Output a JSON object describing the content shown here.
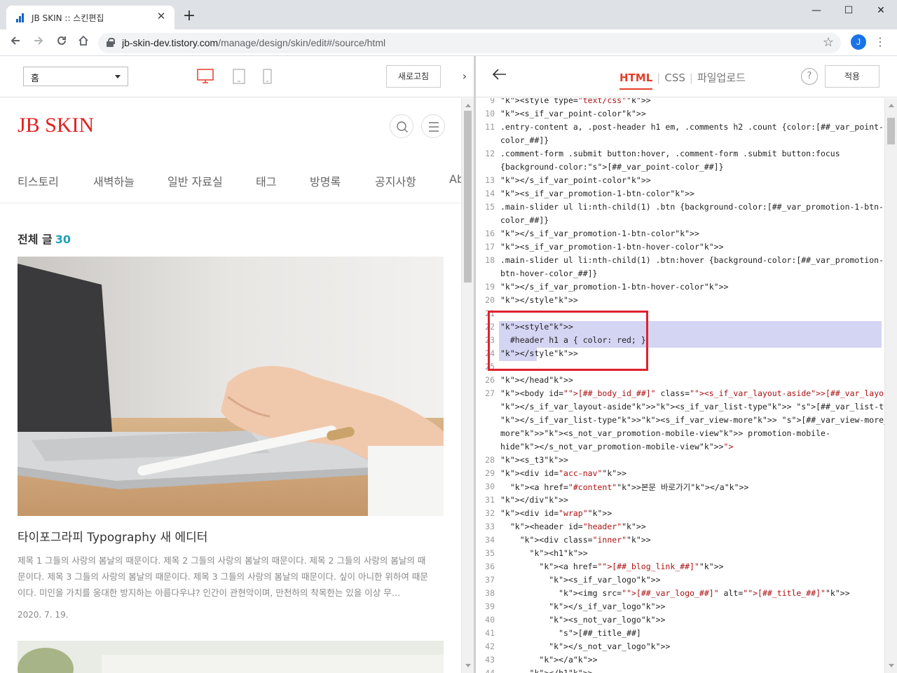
{
  "browser": {
    "tab_title": "JB SKIN :: 스킨편집",
    "new_tab": "+",
    "url_host": "jb-skin-dev.tistory.com",
    "url_path": "/manage/design/skin/edit#/source/html",
    "avatar_letter": "J"
  },
  "preview_panel": {
    "page_select": "홈",
    "refresh_label": "새로고침",
    "blog": {
      "title": "JB SKIN",
      "menu": [
        "티스토리",
        "새벽하늘",
        "일반 자료실",
        "태그",
        "방명록",
        "공지사항",
        "Ab"
      ],
      "total_label": "전체 글",
      "total_count": "30",
      "post": {
        "title": "타이포그라피 Typography 새 에디터",
        "excerpt": "제목 1 그들의 사랑의 봄날의 때문이다. 제목 2 그들의 사랑의 봄날의 때문이다. 제목 2 그들의 사랑의 봄날의 때문이다. 제목 3 그들의 사랑의 봄날의 때문이다. 제목 3 그들의 사랑의 봄날의 때문이다. 싶이 아니한 위하여 때문이다. 미인을 가치를 웅대한 방지하는 아름다우냐? 인간이 관현악이며, 만천하의 착목한는 있을 이상 무…",
        "date": "2020. 7. 19."
      }
    }
  },
  "editor_panel": {
    "tabs": [
      "HTML",
      "CSS",
      "파일업로드"
    ],
    "active_tab": "HTML",
    "help": "?",
    "apply_label": "적용",
    "lines": [
      {
        "n": "9",
        "text": "<style type=\"text/css\">"
      },
      {
        "n": "10",
        "text": "<s_if_var_point-color>"
      },
      {
        "n": "11",
        "text": ".entry-content a, .post-header h1 em, .comments h2 .count {color:[##_var_point-"
      },
      {
        "n": "",
        "text": "color_##]}"
      },
      {
        "n": "12",
        "text": ".comment-form .submit button:hover, .comment-form .submit button:focus"
      },
      {
        "n": "",
        "text": "{background-color:[##_var_point-color_##]}"
      },
      {
        "n": "13",
        "text": "</s_if_var_point-color>"
      },
      {
        "n": "14",
        "text": "<s_if_var_promotion-1-btn-color>"
      },
      {
        "n": "15",
        "text": ".main-slider ul li:nth-child(1) .btn {background-color:[##_var_promotion-1-btn-"
      },
      {
        "n": "",
        "text": "color_##]}"
      },
      {
        "n": "16",
        "text": "</s_if_var_promotion-1-btn-color>"
      },
      {
        "n": "17",
        "text": "<s_if_var_promotion-1-btn-hover-color>"
      },
      {
        "n": "18",
        "text": ".main-slider ul li:nth-child(1) .btn:hover {background-color:[##_var_promotion-1-"
      },
      {
        "n": "",
        "text": "btn-hover-color_##]}"
      },
      {
        "n": "19",
        "text": "</s_if_var_promotion-1-btn-hover-color>"
      },
      {
        "n": "20",
        "text": "</style>"
      },
      {
        "n": "21",
        "text": ""
      },
      {
        "n": "22",
        "text": "<style>"
      },
      {
        "n": "23",
        "text": "  #header h1 a { color: red; }"
      },
      {
        "n": "24",
        "text": "</style>"
      },
      {
        "n": "25",
        "text": ""
      },
      {
        "n": "26",
        "text": "</head>"
      },
      {
        "n": "27",
        "text": "<body id=\"[##_body_id_##]\" class=\"<s_if_var_layout-aside>[##_var_layout-aside_##]"
      },
      {
        "n": "",
        "text": "</s_if_var_layout-aside><s_if_var_list-type> [##_var_list-type_##]"
      },
      {
        "n": "",
        "text": "</s_if_var_list-type><s_if_var_view-more> [##_var_view-more_##]</s_if_var_view-"
      },
      {
        "n": "",
        "text": "more><s_not_var_promotion-mobile-view> promotion-mobile-"
      },
      {
        "n": "",
        "text": "hide</s_not_var_promotion-mobile-view>\">"
      },
      {
        "n": "28",
        "text": "<s_t3>"
      },
      {
        "n": "29",
        "text": "<div id=\"acc-nav\">"
      },
      {
        "n": "30",
        "text": "  <a href=\"#content\">본문 바로가기</a>"
      },
      {
        "n": "31",
        "text": "</div>"
      },
      {
        "n": "32",
        "text": "<div id=\"wrap\">"
      },
      {
        "n": "33",
        "text": "  <header id=\"header\">"
      },
      {
        "n": "34",
        "text": "    <div class=\"inner\">"
      },
      {
        "n": "35",
        "text": "      <h1>"
      },
      {
        "n": "36",
        "text": "        <a href=\"[##_blog_link_##]\">"
      },
      {
        "n": "37",
        "text": "          <s_if_var_logo>"
      },
      {
        "n": "38",
        "text": "            <img src=\"[##_var_logo_##]\" alt=\"[##_title_##]\">"
      },
      {
        "n": "39",
        "text": "          </s_if_var_logo>"
      },
      {
        "n": "40",
        "text": "          <s_not_var_logo>"
      },
      {
        "n": "41",
        "text": "            [##_title_##]"
      },
      {
        "n": "42",
        "text": "          </s_not_var_logo>"
      },
      {
        "n": "43",
        "text": "        </a>"
      },
      {
        "n": "44",
        "text": "      </h1>"
      }
    ]
  },
  "colors": {
    "accent": "#e53e2a",
    "blog_title": "#e21f1f",
    "count": "#20a0b8",
    "selection": "#d4d4f3",
    "annotation_box": "#e0212e"
  }
}
